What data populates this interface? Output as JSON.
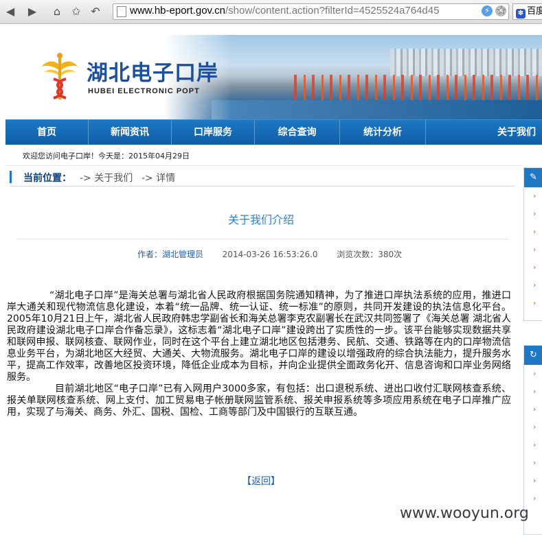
{
  "browser": {
    "url_host": "www.hb-eport.gov.cn",
    "url_path": "/show/content.action?filterId=4525524a764d45",
    "search_label": "百度"
  },
  "banner": {
    "title_cn": "湖北电子口岸",
    "title_en": "HUBEI ELECTRONIC POPT"
  },
  "nav": {
    "items": [
      "首页",
      "新闻资讯",
      "口岸服务",
      "综合查询",
      "统计分析",
      "关于我们"
    ]
  },
  "welcome": "欢迎您访问电子口岸！今天是：2015年04月29日",
  "breadcrumb": {
    "label": "当前位置：",
    "items": [
      "-> 关于我们",
      "-> 详情"
    ]
  },
  "article": {
    "title": "关于我们介绍",
    "author": "作者：湖北管理员",
    "date": "2014-03-26 16:53:26.0",
    "views": "浏览次数：380次",
    "paragraph1": "“湖北电子口岸”是海关总署与湖北省人民政府根据国务院通知精神，为了推进口岸执法系统的应用，推进口岸大通关和现代物流信息化建设，本着“统一品牌、统一认证、统一标准”的原则，共同开发建设的执法信息化平台。2005年10月21日上午，湖北省人民政府韩忠学副省长和海关总署李克农副署长在武汉共同签署了《海关总署 湖北省人民政府建设湖北电子口岸合作备忘录》，这标志着“湖北电子口岸”建设跨出了实质性的一步。该平台能够实现数据共享和联网申报、联网核查、联网作业，同时在这个平台上建立湖北地区包括港务、民航、交通、铁路等在内的口岸物流信息业务平台，为湖北地区大经贸、大通关、大物流服务。湖北电子口岸的建设以增强政府的综合执法能力，提升服务水平，提高工作效率，改善地区投资环境，降低企业成本为目标，并向企业提供全面政务化开、信息咨询和口岸业务网络服务。",
    "paragraph2": "目前湖北地区“电子口岸”已有入网用户3000多家，有包括：出口退税系统、进出口收付汇联网核查系统、报关单联网核查系统、网上支付、加工贸易电子帐册联网监管系统、报关申报系统等多项应用系统在电子口岸推广应用，实现了与海关、商务、外汇、国税、国检、工商等部门及中国银行的互联互通。",
    "back": "【返回】"
  },
  "watermark": "www.wooyun.org",
  "colors": {
    "nav_bg": "#1d77c2",
    "title_blue": "#2d7fd0",
    "arrow_orange": "#e05a1c"
  }
}
